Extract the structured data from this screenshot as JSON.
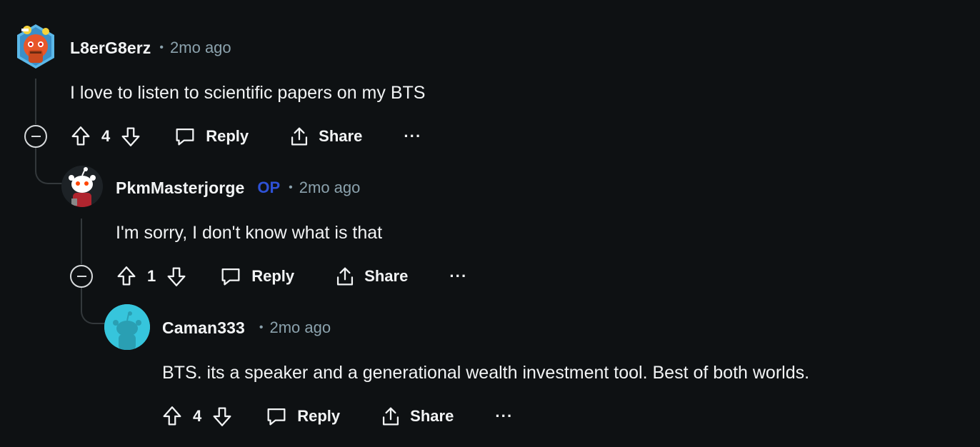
{
  "comments": [
    {
      "author": "L8erG8erz",
      "separator": "•",
      "time": "2mo ago",
      "body": "I love to listen to scientific papers on my BTS",
      "score": "4",
      "reply_label": "Reply",
      "share_label": "Share",
      "more_label": "···"
    },
    {
      "author": "PkmMasterjorge",
      "op_badge": "OP",
      "separator": "•",
      "time": "2mo ago",
      "body": "I'm sorry, I don't know what is that",
      "score": "1",
      "reply_label": "Reply",
      "share_label": "Share",
      "more_label": "···"
    },
    {
      "author": "Caman333",
      "separator": "•",
      "time": "2mo ago",
      "body": "BTS. its a speaker and a generational wealth investment tool. Best of both worlds.",
      "score": "4",
      "reply_label": "Reply",
      "share_label": "Share",
      "more_label": "···"
    }
  ],
  "colors": {
    "background": "#0e1113",
    "text": "#f2f4f5",
    "meta": "#8ba2ad",
    "op_badge": "#2e52d6",
    "thread_line": "#33383b"
  }
}
